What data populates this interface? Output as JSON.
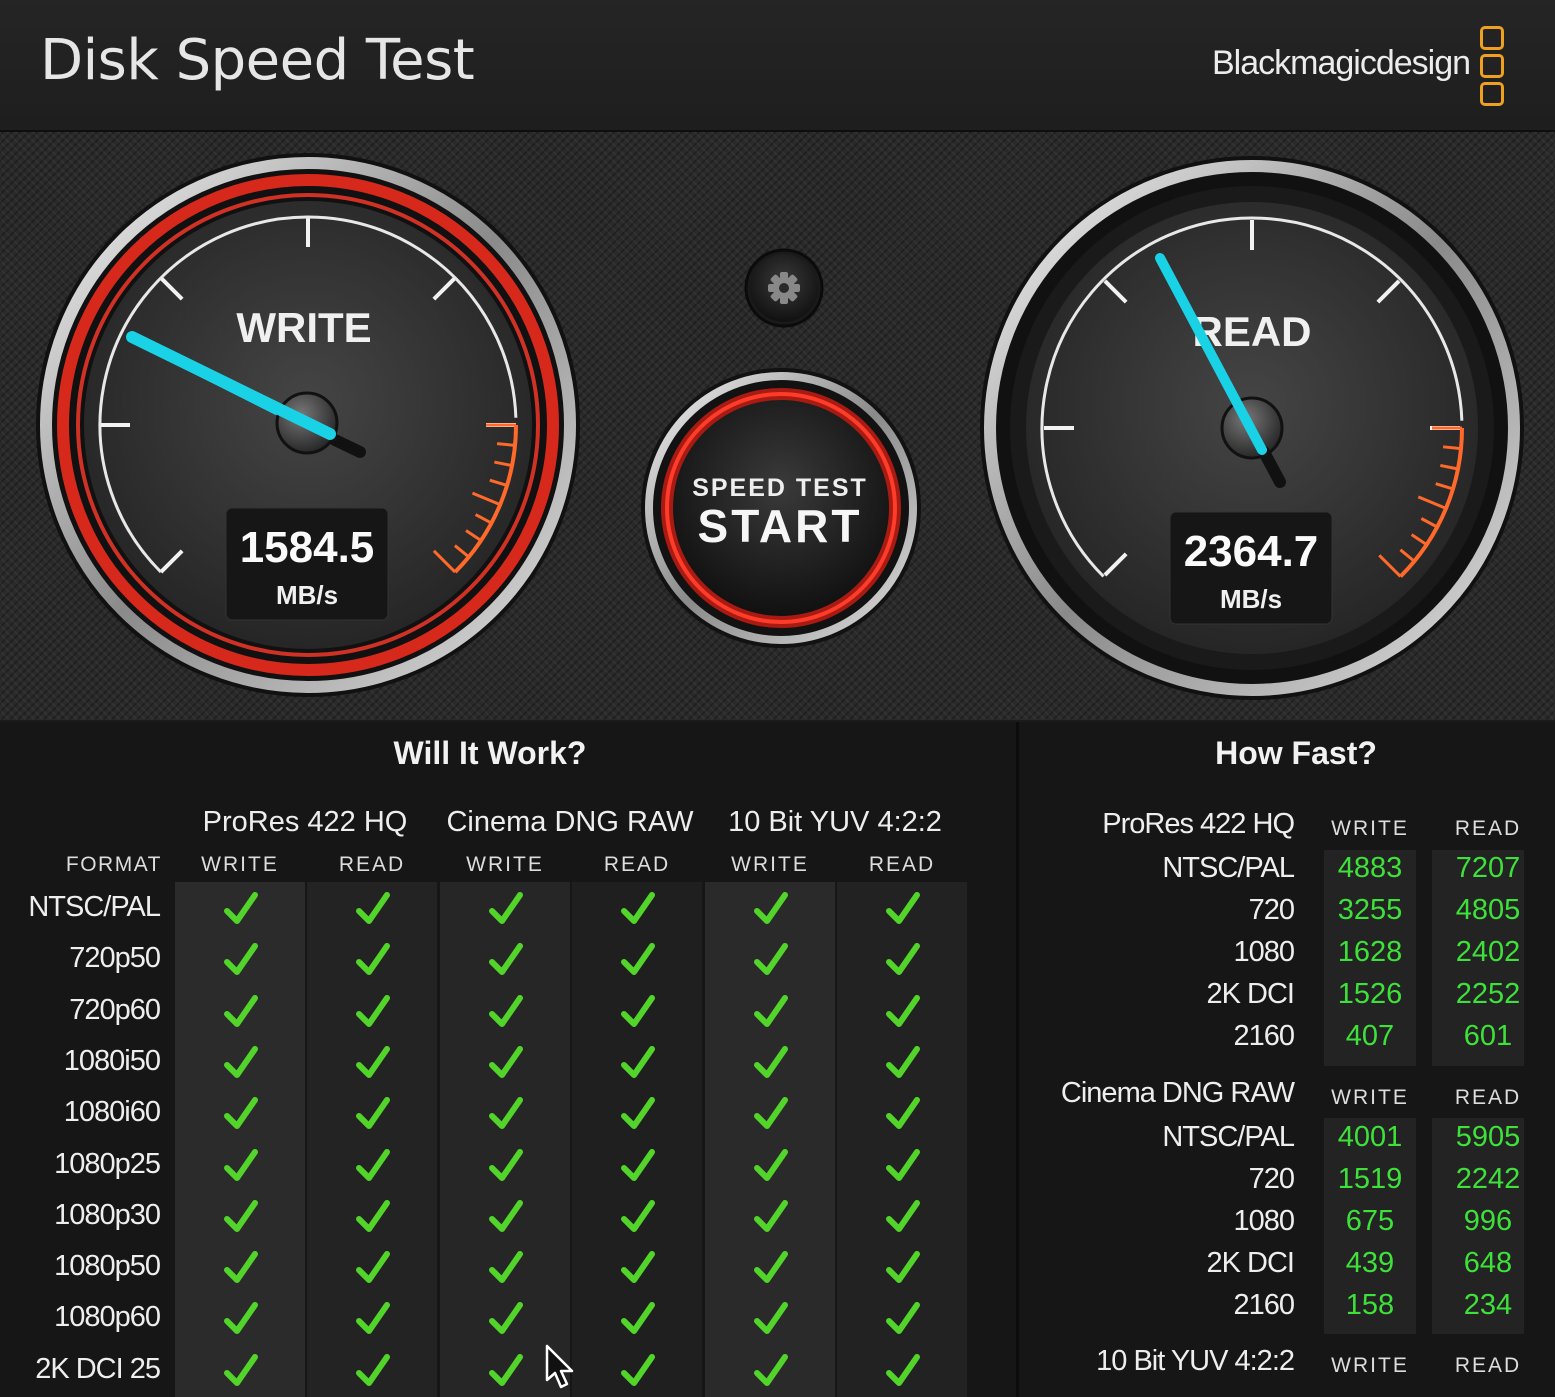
{
  "header": {
    "title": "Disk Speed Test",
    "brand": "Blackmagicdesign"
  },
  "write_gauge": {
    "label": "WRITE",
    "value": "1584.5",
    "unit": "MB/s"
  },
  "read_gauge": {
    "label": "READ",
    "value": "2364.7",
    "unit": "MB/s"
  },
  "start_button": {
    "line1": "SPEED TEST",
    "line2": "START"
  },
  "settings": {
    "icon": "gear-icon"
  },
  "will_it_work": {
    "title": "Will It Work?",
    "format_header": "FORMAT",
    "write_label": "WRITE",
    "read_label": "READ",
    "codecs": [
      "ProRes 422 HQ",
      "Cinema DNG RAW",
      "10 Bit YUV 4:2:2"
    ],
    "formats": [
      "NTSC/PAL",
      "720p50",
      "720p60",
      "1080i50",
      "1080i60",
      "1080p25",
      "1080p30",
      "1080p50",
      "1080p60",
      "2K DCI 25"
    ],
    "check_icon": "check-icon",
    "check_color": "#52d42a"
  },
  "how_fast": {
    "title": "How Fast?",
    "write_label": "WRITE",
    "read_label": "READ",
    "value_color": "#3ee03a",
    "groups": [
      {
        "name": "ProRes 422 HQ",
        "rows": [
          {
            "label": "NTSC/PAL",
            "write": "4883",
            "read": "7207"
          },
          {
            "label": "720",
            "write": "3255",
            "read": "4805"
          },
          {
            "label": "1080",
            "write": "1628",
            "read": "2402"
          },
          {
            "label": "2K DCI",
            "write": "1526",
            "read": "2252"
          },
          {
            "label": "2160",
            "write": "407",
            "read": "601"
          }
        ]
      },
      {
        "name": "Cinema DNG RAW",
        "rows": [
          {
            "label": "NTSC/PAL",
            "write": "4001",
            "read": "5905"
          },
          {
            "label": "720",
            "write": "1519",
            "read": "2242"
          },
          {
            "label": "1080",
            "write": "675",
            "read": "996"
          },
          {
            "label": "2K DCI",
            "write": "439",
            "read": "648"
          },
          {
            "label": "2160",
            "write": "158",
            "read": "234"
          }
        ]
      },
      {
        "name": "10 Bit YUV 4:2:2",
        "rows": []
      }
    ]
  }
}
